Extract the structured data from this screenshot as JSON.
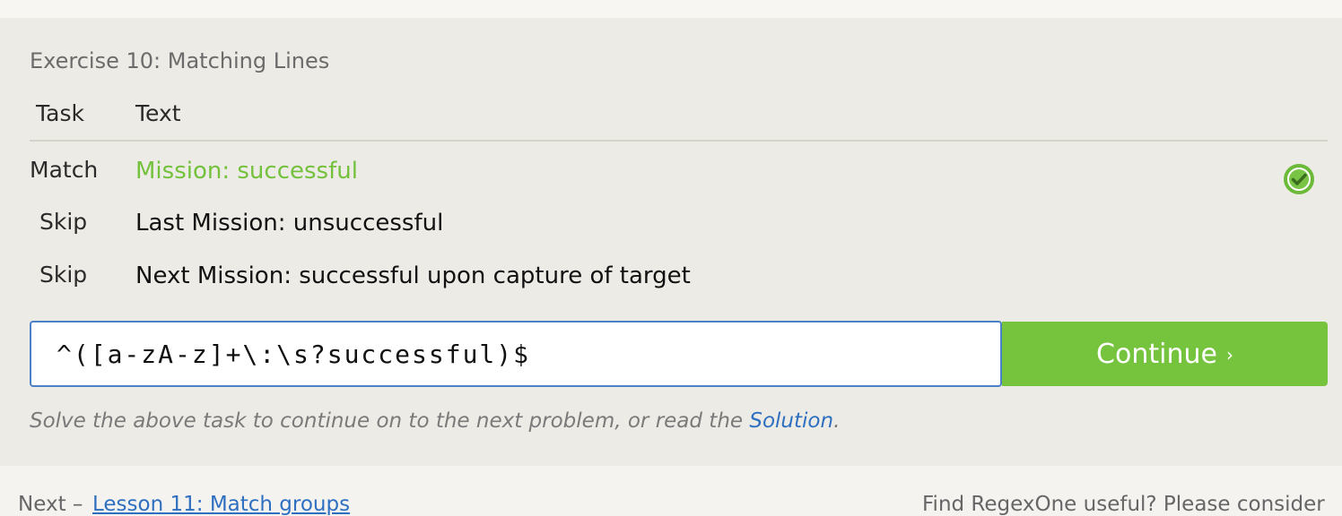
{
  "exercise": {
    "title": "Exercise 10: Matching Lines",
    "header": {
      "task": "Task",
      "text": "Text"
    },
    "rows": [
      {
        "task": "Match",
        "text": "Mission: successful",
        "status": "matched"
      },
      {
        "task": "Skip",
        "text": "Last Mission: unsuccessful"
      },
      {
        "task": "Skip",
        "text": "Next Mission: successful upon capture of target"
      }
    ],
    "input_value": "^([a-zA-z]+\\:\\s?successful)$",
    "continue_label": "Continue",
    "continue_chevron": "›",
    "hint_before": "Solve the above task to continue on to the next problem, or read the ",
    "hint_link": "Solution",
    "hint_after": "."
  },
  "footer": {
    "next_label": "Next –",
    "next_link": "Lesson 11: Match groups",
    "promo": "Find RegexOne useful? Please consider"
  },
  "colors": {
    "panel": "#edebe5",
    "accent_green": "#76c33e",
    "matched_text": "#74c13e",
    "link_blue": "#2f6fc0",
    "input_border": "#4a80c8"
  },
  "icons": {
    "row_match_status": "check-circle-icon"
  }
}
